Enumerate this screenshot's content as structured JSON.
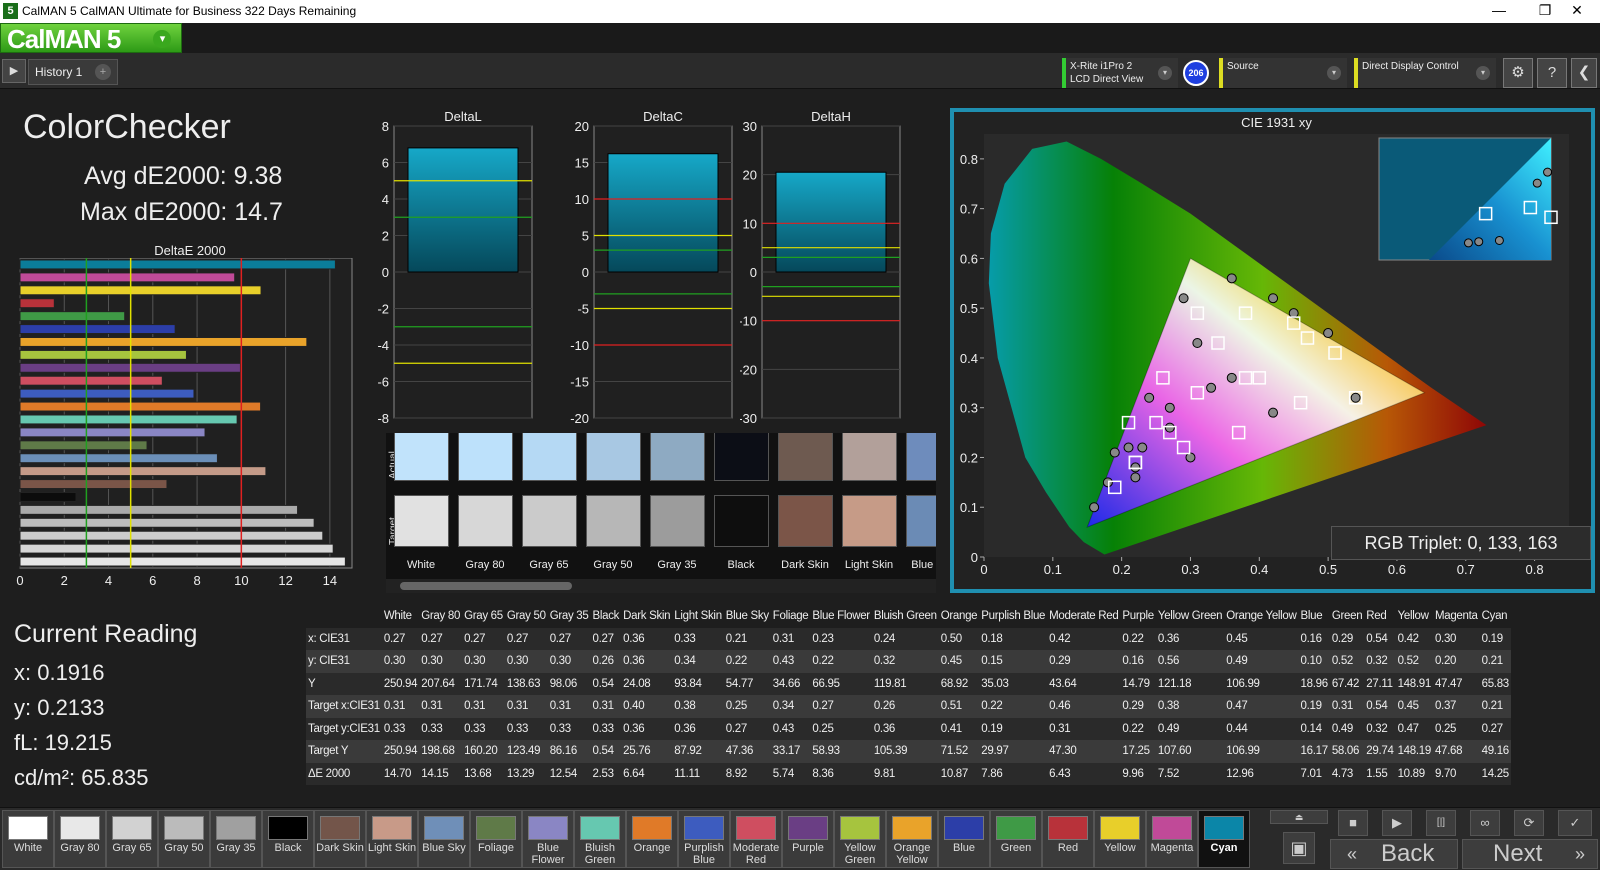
{
  "titlebar": {
    "title": "CalMAN 5 CalMAN Ultimate for Business 322 Days Remaining",
    "icon": "5",
    "min": "—",
    "max": "❐",
    "close": "✕"
  },
  "logo": {
    "text": "CalMAN 5",
    "dd": "▾"
  },
  "toolbar": {
    "tab": "History 1",
    "plus": "+",
    "play": "▶",
    "meter": {
      "line1": "X-Rite i1Pro 2",
      "line2": "LCD Direct View",
      "arrow": "▾"
    },
    "badge": "206",
    "source": {
      "label": "Source",
      "arrow": "▾"
    },
    "display": {
      "label": "Direct Display Control",
      "arrow": "▾"
    },
    "gear": "⚙",
    "help": "?",
    "collapse": "❮"
  },
  "summary": {
    "title": "ColorChecker",
    "avg": "Avg dE2000: 9.38",
    "max": "Max dE2000: 14.7",
    "de_title": "DeltaE 2000"
  },
  "current": {
    "title": "Current Reading",
    "x": "x: 0.1916",
    "y": "y: 0.2133",
    "fl": "fL: 19.215",
    "cdm": "cd/m²: 65.835"
  },
  "colors": {
    "accent": "#1f8fb0",
    "bar": "#0b7d9a",
    "yellow": "#e0e000",
    "red": "#e02020",
    "green": "#20a020"
  },
  "chart_data": [
    {
      "type": "bar",
      "title": "DeltaE 2000",
      "orientation": "horizontal",
      "xlim": [
        0,
        15
      ],
      "xticks": [
        0,
        2,
        4,
        6,
        8,
        10,
        12,
        14
      ],
      "categories": [
        "White",
        "Gray 80",
        "Gray 65",
        "Gray 50",
        "Gray 35",
        "Black",
        "Dark Skin",
        "Light Skin",
        "Blue Sky",
        "Foliage",
        "Blue Flower",
        "Bluish Green",
        "Orange",
        "Purplish Blue",
        "Moderate Red",
        "Purple",
        "Yellow Green",
        "Orange Yellow",
        "Blue",
        "Green",
        "Red",
        "Yellow",
        "Magenta",
        "Cyan"
      ],
      "values": [
        14.7,
        14.15,
        13.68,
        13.29,
        12.54,
        2.53,
        6.64,
        11.11,
        8.92,
        5.74,
        8.36,
        9.81,
        10.87,
        7.86,
        6.43,
        9.96,
        7.52,
        12.96,
        7.01,
        4.73,
        1.55,
        10.89,
        9.7,
        14.25
      ],
      "colors": [
        "#e6e6e6",
        "#d6d6d6",
        "#cccccc",
        "#bdbdbd",
        "#aaaaaa",
        "#0c0c0c",
        "#7a5548",
        "#c49a88",
        "#6b8fb8",
        "#5f7a48",
        "#8a86c4",
        "#66c8b0",
        "#e07a28",
        "#3d5cbf",
        "#cf4e60",
        "#6a3e84",
        "#a6c43e",
        "#e9a32a",
        "#2c3ea8",
        "#3f9a46",
        "#b8323a",
        "#e8cf2a",
        "#c04a98",
        "#0b7d9a"
      ],
      "ref_lines": [
        {
          "x": 3,
          "color": "#20a020"
        },
        {
          "x": 5,
          "color": "#e0e000"
        },
        {
          "x": 10,
          "color": "#e02020"
        }
      ]
    },
    {
      "type": "bar",
      "title": "DeltaL",
      "ylim": [
        -8,
        8
      ],
      "yticks": [
        8,
        6,
        4,
        2,
        0,
        -2,
        -4,
        -6,
        -8
      ],
      "values": [
        6.8
      ],
      "ref_lines": [
        {
          "y": 5,
          "color": "#e0e000"
        },
        {
          "y": 3,
          "color": "#20a020"
        },
        {
          "y": -3,
          "color": "#20a020"
        },
        {
          "y": -5,
          "color": "#e0e000"
        }
      ]
    },
    {
      "type": "bar",
      "title": "DeltaC",
      "ylim": [
        -20,
        20
      ],
      "yticks": [
        20,
        15,
        10,
        5,
        0,
        -5,
        -10,
        -15,
        -20
      ],
      "values": [
        16.2
      ],
      "ref_lines": [
        {
          "y": 10,
          "color": "#e02020"
        },
        {
          "y": 5,
          "color": "#e0e000"
        },
        {
          "y": 3,
          "color": "#20a020"
        },
        {
          "y": -3,
          "color": "#20a020"
        },
        {
          "y": -5,
          "color": "#e0e000"
        },
        {
          "y": -10,
          "color": "#e02020"
        }
      ]
    },
    {
      "type": "bar",
      "title": "DeltaH",
      "ylim": [
        -30,
        30
      ],
      "yticks": [
        30,
        20,
        10,
        0,
        -10,
        -20,
        -30
      ],
      "values": [
        20.5
      ],
      "ref_lines": [
        {
          "y": 10,
          "color": "#e02020"
        },
        {
          "y": 5,
          "color": "#e0e000"
        },
        {
          "y": 3,
          "color": "#20a020"
        },
        {
          "y": -3,
          "color": "#20a020"
        },
        {
          "y": -5,
          "color": "#e0e000"
        },
        {
          "y": -10,
          "color": "#e02020"
        }
      ]
    },
    {
      "type": "scatter",
      "title": "CIE 1931 xy",
      "xlim": [
        0,
        0.85
      ],
      "ylim": [
        0,
        0.85
      ],
      "xticks": [
        0,
        0.1,
        0.2,
        0.3,
        0.4,
        0.5,
        0.6,
        0.7,
        0.8
      ],
      "yticks": [
        0,
        0.1,
        0.2,
        0.3,
        0.4,
        0.5,
        0.6,
        0.7,
        0.8
      ],
      "triangle": [
        [
          0.64,
          0.33
        ],
        [
          0.3,
          0.6
        ],
        [
          0.15,
          0.06
        ]
      ],
      "targets": [
        [
          0.31,
          0.33
        ],
        [
          0.4,
          0.36
        ],
        [
          0.38,
          0.36
        ],
        [
          0.25,
          0.27
        ],
        [
          0.34,
          0.43
        ],
        [
          0.27,
          0.25
        ],
        [
          0.26,
          0.36
        ],
        [
          0.51,
          0.41
        ],
        [
          0.22,
          0.19
        ],
        [
          0.46,
          0.31
        ],
        [
          0.29,
          0.22
        ],
        [
          0.38,
          0.49
        ],
        [
          0.47,
          0.44
        ],
        [
          0.19,
          0.14
        ],
        [
          0.31,
          0.49
        ],
        [
          0.54,
          0.32
        ],
        [
          0.45,
          0.47
        ],
        [
          0.37,
          0.25
        ],
        [
          0.21,
          0.27
        ],
        [
          0.22,
          0.19
        ]
      ],
      "actuals": [
        [
          0.27,
          0.3
        ],
        [
          0.36,
          0.36
        ],
        [
          0.33,
          0.34
        ],
        [
          0.21,
          0.22
        ],
        [
          0.31,
          0.43
        ],
        [
          0.23,
          0.22
        ],
        [
          0.24,
          0.32
        ],
        [
          0.5,
          0.45
        ],
        [
          0.18,
          0.15
        ],
        [
          0.42,
          0.29
        ],
        [
          0.22,
          0.16
        ],
        [
          0.36,
          0.56
        ],
        [
          0.45,
          0.49
        ],
        [
          0.16,
          0.1
        ],
        [
          0.29,
          0.52
        ],
        [
          0.54,
          0.32
        ],
        [
          0.42,
          0.52
        ],
        [
          0.3,
          0.2
        ],
        [
          0.19,
          0.21
        ],
        [
          0.22,
          0.18
        ],
        [
          0.27,
          0.26
        ]
      ],
      "inset": {
        "actuals": [
          [
            0.52,
            0.14
          ],
          [
            0.58,
            0.15
          ],
          [
            0.7,
            0.16
          ],
          [
            0.92,
            0.63
          ],
          [
            0.98,
            0.72
          ]
        ],
        "targets": [
          [
            0.62,
            0.38
          ],
          [
            0.88,
            0.43
          ],
          [
            1.0,
            0.35
          ]
        ]
      }
    }
  ],
  "cie": {
    "rgb_triplet": "RGB Triplet: 0, 133, 163"
  },
  "swatches": {
    "row_actual": "Actual",
    "row_target": "Target",
    "items": [
      {
        "label": "White",
        "actual": "#c1e3fb",
        "target": "#e1e1e1"
      },
      {
        "label": "Gray 80",
        "actual": "#bde1fb",
        "target": "#d7d7d7"
      },
      {
        "label": "Gray 65",
        "actual": "#b5d9f4",
        "target": "#cbcbcb"
      },
      {
        "label": "Gray 50",
        "actual": "#a8c8e3",
        "target": "#b7b7b7"
      },
      {
        "label": "Gray 35",
        "actual": "#8eaac2",
        "target": "#9c9c9c"
      },
      {
        "label": "Black",
        "actual": "#0c0e16",
        "target": "#0e0e0e"
      },
      {
        "label": "Dark Skin",
        "actual": "#6e5a50",
        "target": "#7b5548"
      },
      {
        "label": "Light Skin",
        "actual": "#b2a09a",
        "target": "#c69b87"
      },
      {
        "label": "Blue Sky",
        "actual": "#6e8cbc",
        "target": "#6b8bb5"
      }
    ]
  },
  "table": {
    "columns": [
      "",
      "White",
      "Gray 80",
      "Gray 65",
      "Gray 50",
      "Gray 35",
      "Black",
      "Dark Skin",
      "Light Skin",
      "Blue Sky",
      "Foliage",
      "Blue Flower",
      "Bluish Green",
      "Orange",
      "Purplish Blue",
      "Moderate Red",
      "Purple",
      "Yellow Green",
      "Orange Yellow",
      "Blue",
      "Green",
      "Red",
      "Yellow",
      "Magenta",
      "Cyan"
    ],
    "rows": [
      [
        "x: CIE31",
        "0.27",
        "0.27",
        "0.27",
        "0.27",
        "0.27",
        "0.27",
        "0.36",
        "0.33",
        "0.21",
        "0.31",
        "0.23",
        "0.24",
        "0.50",
        "0.18",
        "0.42",
        "0.22",
        "0.36",
        "0.45",
        "0.16",
        "0.29",
        "0.54",
        "0.42",
        "0.30",
        "0.19"
      ],
      [
        "y: CIE31",
        "0.30",
        "0.30",
        "0.30",
        "0.30",
        "0.30",
        "0.26",
        "0.36",
        "0.34",
        "0.22",
        "0.43",
        "0.22",
        "0.32",
        "0.45",
        "0.15",
        "0.29",
        "0.16",
        "0.56",
        "0.49",
        "0.10",
        "0.52",
        "0.32",
        "0.52",
        "0.20",
        "0.21"
      ],
      [
        "Y",
        "250.94",
        "207.64",
        "171.74",
        "138.63",
        "98.06",
        "0.54",
        "24.08",
        "93.84",
        "54.77",
        "34.66",
        "66.95",
        "119.81",
        "68.92",
        "35.03",
        "43.64",
        "14.79",
        "121.18",
        "106.99",
        "18.96",
        "67.42",
        "27.11",
        "148.91",
        "47.47",
        "65.83"
      ],
      [
        "Target x:CIE31",
        "0.31",
        "0.31",
        "0.31",
        "0.31",
        "0.31",
        "0.31",
        "0.40",
        "0.38",
        "0.25",
        "0.34",
        "0.27",
        "0.26",
        "0.51",
        "0.22",
        "0.46",
        "0.29",
        "0.38",
        "0.47",
        "0.19",
        "0.31",
        "0.54",
        "0.45",
        "0.37",
        "0.21"
      ],
      [
        "Target y:CIE31",
        "0.33",
        "0.33",
        "0.33",
        "0.33",
        "0.33",
        "0.33",
        "0.36",
        "0.36",
        "0.27",
        "0.43",
        "0.25",
        "0.36",
        "0.41",
        "0.19",
        "0.31",
        "0.22",
        "0.49",
        "0.44",
        "0.14",
        "0.49",
        "0.32",
        "0.47",
        "0.25",
        "0.27"
      ],
      [
        "Target Y",
        "250.94",
        "198.68",
        "160.20",
        "123.49",
        "86.16",
        "0.54",
        "25.76",
        "87.92",
        "47.36",
        "33.17",
        "58.93",
        "105.39",
        "71.52",
        "29.97",
        "47.30",
        "17.25",
        "107.60",
        "106.99",
        "16.17",
        "58.06",
        "29.74",
        "148.19",
        "47.68",
        "49.16"
      ],
      [
        "ΔE 2000",
        "14.70",
        "14.15",
        "13.68",
        "13.29",
        "12.54",
        "2.53",
        "6.64",
        "11.11",
        "8.92",
        "5.74",
        "8.36",
        "9.81",
        "10.87",
        "7.86",
        "6.43",
        "9.96",
        "7.52",
        "12.96",
        "7.01",
        "4.73",
        "1.55",
        "10.89",
        "9.70",
        "14.25"
      ]
    ]
  },
  "bottom": {
    "items": [
      {
        "label": "White",
        "color": "#ffffff"
      },
      {
        "label": "Gray 80",
        "color": "#e8e8e8"
      },
      {
        "label": "Gray 65",
        "color": "#d2d2d2"
      },
      {
        "label": "Gray 50",
        "color": "#bbbbbb"
      },
      {
        "label": "Gray 35",
        "color": "#a0a0a0"
      },
      {
        "label": "Black",
        "color": "#000000"
      },
      {
        "label": "Dark Skin",
        "color": "#73554a"
      },
      {
        "label": "Light Skin",
        "color": "#c89a88"
      },
      {
        "label": "Blue Sky",
        "color": "#6f8fb8"
      },
      {
        "label": "Foliage",
        "color": "#5f7a48"
      },
      {
        "label": "Blue Flower",
        "color": "#8a86c4"
      },
      {
        "label": "Bluish Green",
        "color": "#66c8b0"
      },
      {
        "label": "Orange",
        "color": "#e07a28"
      },
      {
        "label": "Purplish Blue",
        "color": "#3d5cbf"
      },
      {
        "label": "Moderate Red",
        "color": "#cf4e60"
      },
      {
        "label": "Purple",
        "color": "#6a3e84"
      },
      {
        "label": "Yellow Green",
        "color": "#a6c43e"
      },
      {
        "label": "Orange Yellow",
        "color": "#e9a32a"
      },
      {
        "label": "Blue",
        "color": "#2c3ea8"
      },
      {
        "label": "Green",
        "color": "#3f9a46"
      },
      {
        "label": "Red",
        "color": "#b8323a"
      },
      {
        "label": "Yellow",
        "color": "#e8cf2a"
      },
      {
        "label": "Magenta",
        "color": "#c04a98"
      },
      {
        "label": "Cyan",
        "color": "#0b86a8"
      }
    ],
    "selected": "Cyan",
    "back": "Back",
    "next": "Next",
    "back_arrow": "«",
    "next_arrow": "»",
    "icons": {
      "stop": "■",
      "play": "▶",
      "bracket": "[|]",
      "loop": "∞",
      "refresh": "⟳",
      "check": "✓",
      "eject": "⏏",
      "box": "▣"
    }
  }
}
